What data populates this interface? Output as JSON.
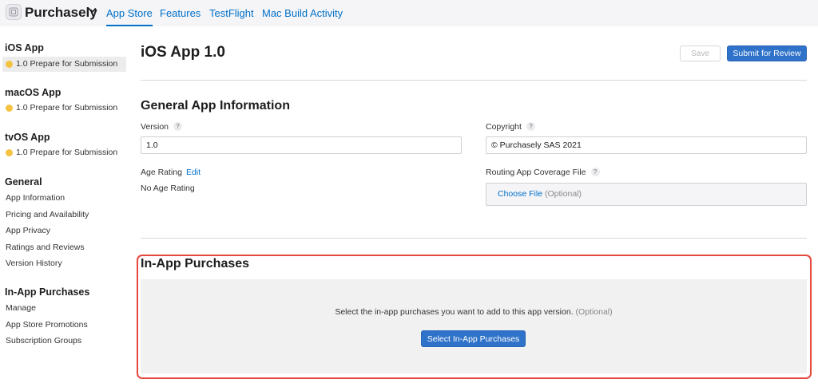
{
  "topbar": {
    "app_name": "Purchasely",
    "tabs": [
      {
        "label": "App Store",
        "active": true
      },
      {
        "label": "Features",
        "active": false
      },
      {
        "label": "TestFlight",
        "active": false
      },
      {
        "label": "Mac Build Activity",
        "active": false
      }
    ]
  },
  "sidebar": {
    "platforms": [
      {
        "title": "iOS App",
        "version": "1.0 Prepare for Submission",
        "active": true
      },
      {
        "title": "macOS App",
        "version": "1.0 Prepare for Submission",
        "active": false
      },
      {
        "title": "tvOS App",
        "version": "1.0 Prepare for Submission",
        "active": false
      }
    ],
    "general": {
      "title": "General",
      "items": [
        "App Information",
        "Pricing and Availability",
        "App Privacy",
        "Ratings and Reviews",
        "Version History"
      ]
    },
    "iap": {
      "title": "In-App Purchases",
      "items": [
        "Manage",
        "App Store Promotions",
        "Subscription Groups"
      ]
    },
    "status_color": "#f5c342"
  },
  "main": {
    "title": "iOS App 1.0",
    "save_label": "Save",
    "submit_label": "Submit for Review",
    "general_info": {
      "title": "General App Information",
      "version_label": "Version",
      "version_value": "1.0",
      "copyright_label": "Copyright",
      "copyright_value": "© Purchasely SAS 2021",
      "age_rating_label": "Age Rating",
      "age_rating_edit": "Edit",
      "age_rating_value": "No Age Rating",
      "routing_label": "Routing App Coverage File",
      "choose_file": "Choose File",
      "optional": "(Optional)",
      "help_glyph": "?"
    },
    "iap": {
      "title": "In-App Purchases",
      "message": "Select the in-app purchases you want to add to this app version.",
      "optional": "(Optional)",
      "button": "Select In-App Purchases"
    }
  },
  "colors": {
    "accent": "#0070c9",
    "primary_button": "#2f72c9",
    "highlight": "#e5483d"
  }
}
